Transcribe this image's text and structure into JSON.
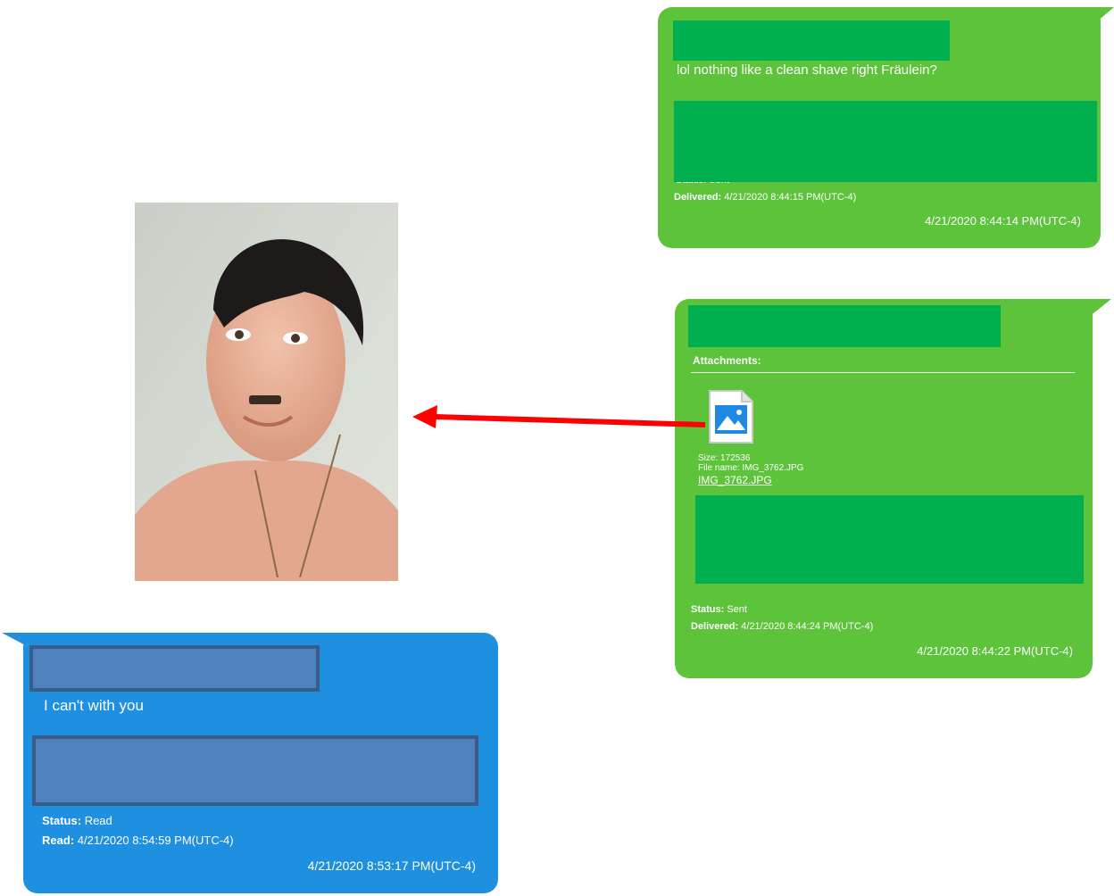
{
  "messages": [
    {
      "text": "lol nothing like a clean shave right Fräulein?",
      "status_fragment": "Status: Sent",
      "delivered_label": "Delivered:",
      "delivered_value": "4/21/2020 8:44:15 PM(UTC-4)",
      "timestamp": "4/21/2020 8:44:14 PM(UTC-4)"
    },
    {
      "attachments_label": "Attachments:",
      "file_size": "Size: 172536",
      "file_name_meta": "File name: IMG_3762.JPG",
      "file_link": "IMG_3762.JPG",
      "status_label": "Status:",
      "status_value": "Sent",
      "delivered_label": "Delivered:",
      "delivered_value": "4/21/2020 8:44:24 PM(UTC-4)",
      "timestamp": "4/21/2020 8:44:22 PM(UTC-4)"
    },
    {
      "text": "I can't with you",
      "status_label": "Status:",
      "status_value": "Read",
      "read_label": "Read:",
      "read_value": "4/21/2020 8:54:59 PM(UTC-4)",
      "timestamp": "4/21/2020 8:53:17 PM(UTC-4)"
    }
  ],
  "colors": {
    "outgoing_bubble": "#5cc33b",
    "incoming_bubble": "#1f8fdf",
    "redaction_green": "#00b04e",
    "redaction_blue": "#4f81bd",
    "arrow": "#ff0000"
  },
  "icons": {
    "attachment": "image-file-icon",
    "pointer": "red-arrow-icon"
  }
}
